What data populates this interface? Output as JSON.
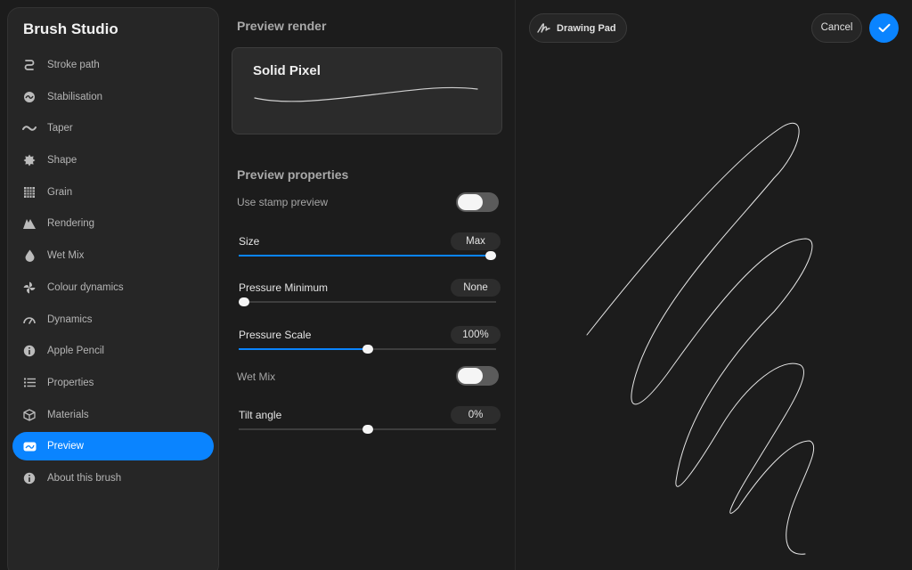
{
  "sidebar": {
    "title": "Brush Studio",
    "items": [
      {
        "label": "Stroke path",
        "icon": "stroke-path-icon"
      },
      {
        "label": "Stabilisation",
        "icon": "stabilisation-icon"
      },
      {
        "label": "Taper",
        "icon": "taper-icon"
      },
      {
        "label": "Shape",
        "icon": "shape-icon"
      },
      {
        "label": "Grain",
        "icon": "grain-icon"
      },
      {
        "label": "Rendering",
        "icon": "rendering-icon"
      },
      {
        "label": "Wet Mix",
        "icon": "wet-mix-icon"
      },
      {
        "label": "Colour dynamics",
        "icon": "colour-dynamics-icon"
      },
      {
        "label": "Dynamics",
        "icon": "dynamics-icon"
      },
      {
        "label": "Apple Pencil",
        "icon": "apple-pencil-icon"
      },
      {
        "label": "Properties",
        "icon": "properties-icon"
      },
      {
        "label": "Materials",
        "icon": "materials-icon"
      },
      {
        "label": "Preview",
        "icon": "preview-icon",
        "active": true
      },
      {
        "label": "About this brush",
        "icon": "about-icon"
      }
    ]
  },
  "preview_render": {
    "heading": "Preview render",
    "brush_name": "Solid Pixel"
  },
  "preview_properties": {
    "heading": "Preview properties",
    "use_stamp_preview": {
      "label": "Use stamp preview",
      "on": false
    },
    "size": {
      "label": "Size",
      "value": "Max",
      "level": 1.0
    },
    "pressure_minimum": {
      "label": "Pressure Minimum",
      "value": "None",
      "level": 0.0
    },
    "pressure_scale": {
      "label": "Pressure Scale",
      "value": "100%",
      "level": 0.5
    },
    "wet_mix": {
      "label": "Wet Mix",
      "on": false
    },
    "tilt_angle": {
      "label": "Tilt angle",
      "value": "0%",
      "level": 0.5
    }
  },
  "canvas": {
    "drawing_pad_label": "Drawing Pad",
    "cancel_label": "Cancel"
  },
  "colors": {
    "accent": "#0a84ff",
    "background": "#1c1c1c",
    "panel": "#262626"
  }
}
